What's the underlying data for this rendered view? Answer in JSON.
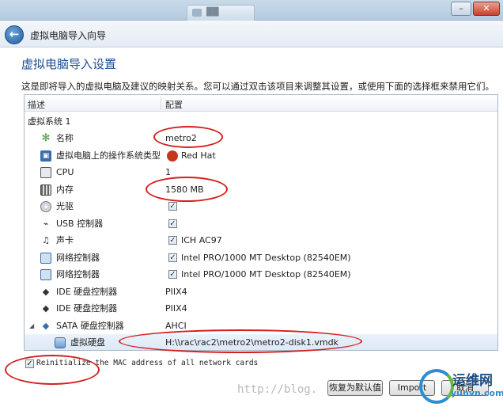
{
  "titlebar": {
    "tab_label": "██",
    "minimize": "–",
    "close": "✕"
  },
  "nav": {
    "back_icon": "back-arrow-icon",
    "title": "虚拟电脑导入向导"
  },
  "page": {
    "heading": "虚拟电脑导入设置",
    "description": "这是即将导入的虚拟电脑及建议的映射关系。您可以通过双击该项目来调整其设置，或使用下面的选择框来禁用它们。"
  },
  "table": {
    "headers": {
      "description": "描述",
      "config": "配置"
    },
    "group": "虚拟系统 1",
    "rows": [
      {
        "icon": "name-icon",
        "label": "名称",
        "value": "metro2"
      },
      {
        "icon": "os-type-icon",
        "label": "虚拟电脑上的操作系统类型",
        "value": "Red Hat"
      },
      {
        "icon": "cpu-icon",
        "label": "CPU",
        "value": "1"
      },
      {
        "icon": "memory-icon",
        "label": "内存",
        "value": "1580 MB"
      },
      {
        "icon": "optical-drive-icon",
        "label": "光驱",
        "value": ""
      },
      {
        "icon": "usb-icon",
        "label": "USB 控制器",
        "value": ""
      },
      {
        "icon": "sound-card-icon",
        "label": "声卡",
        "value": "ICH AC97"
      },
      {
        "icon": "network-icon",
        "label": "网络控制器",
        "value": "Intel PRO/1000 MT Desktop (82540EM)"
      },
      {
        "icon": "network-icon",
        "label": "网络控制器",
        "value": "Intel PRO/1000 MT Desktop (82540EM)"
      },
      {
        "icon": "ide-controller-icon",
        "label": "IDE 硬盘控制器",
        "value": "PIIX4"
      },
      {
        "icon": "ide-controller-icon",
        "label": "IDE 硬盘控制器",
        "value": "PIIX4"
      },
      {
        "icon": "sata-controller-icon",
        "label": "SATA 硬盘控制器",
        "value": "AHCI"
      },
      {
        "icon": "hard-disk-icon",
        "label": "虚拟硬盘",
        "value": "H:\\\\rac\\rac2\\metro2\\metro2-disk1.vmdk"
      }
    ]
  },
  "reinit": {
    "checked": true,
    "label": "Reinitialize the MAC address of all network cards"
  },
  "buttons": {
    "restore_defaults": "恢复为默认值",
    "import": "Import",
    "cancel": "取消"
  },
  "watermark": "http://blog.",
  "logo": {
    "text": "运维网",
    "domain": "yunvn.com"
  },
  "colors": {
    "annotation": "#d61e1e",
    "heading": "#1e4f91"
  }
}
